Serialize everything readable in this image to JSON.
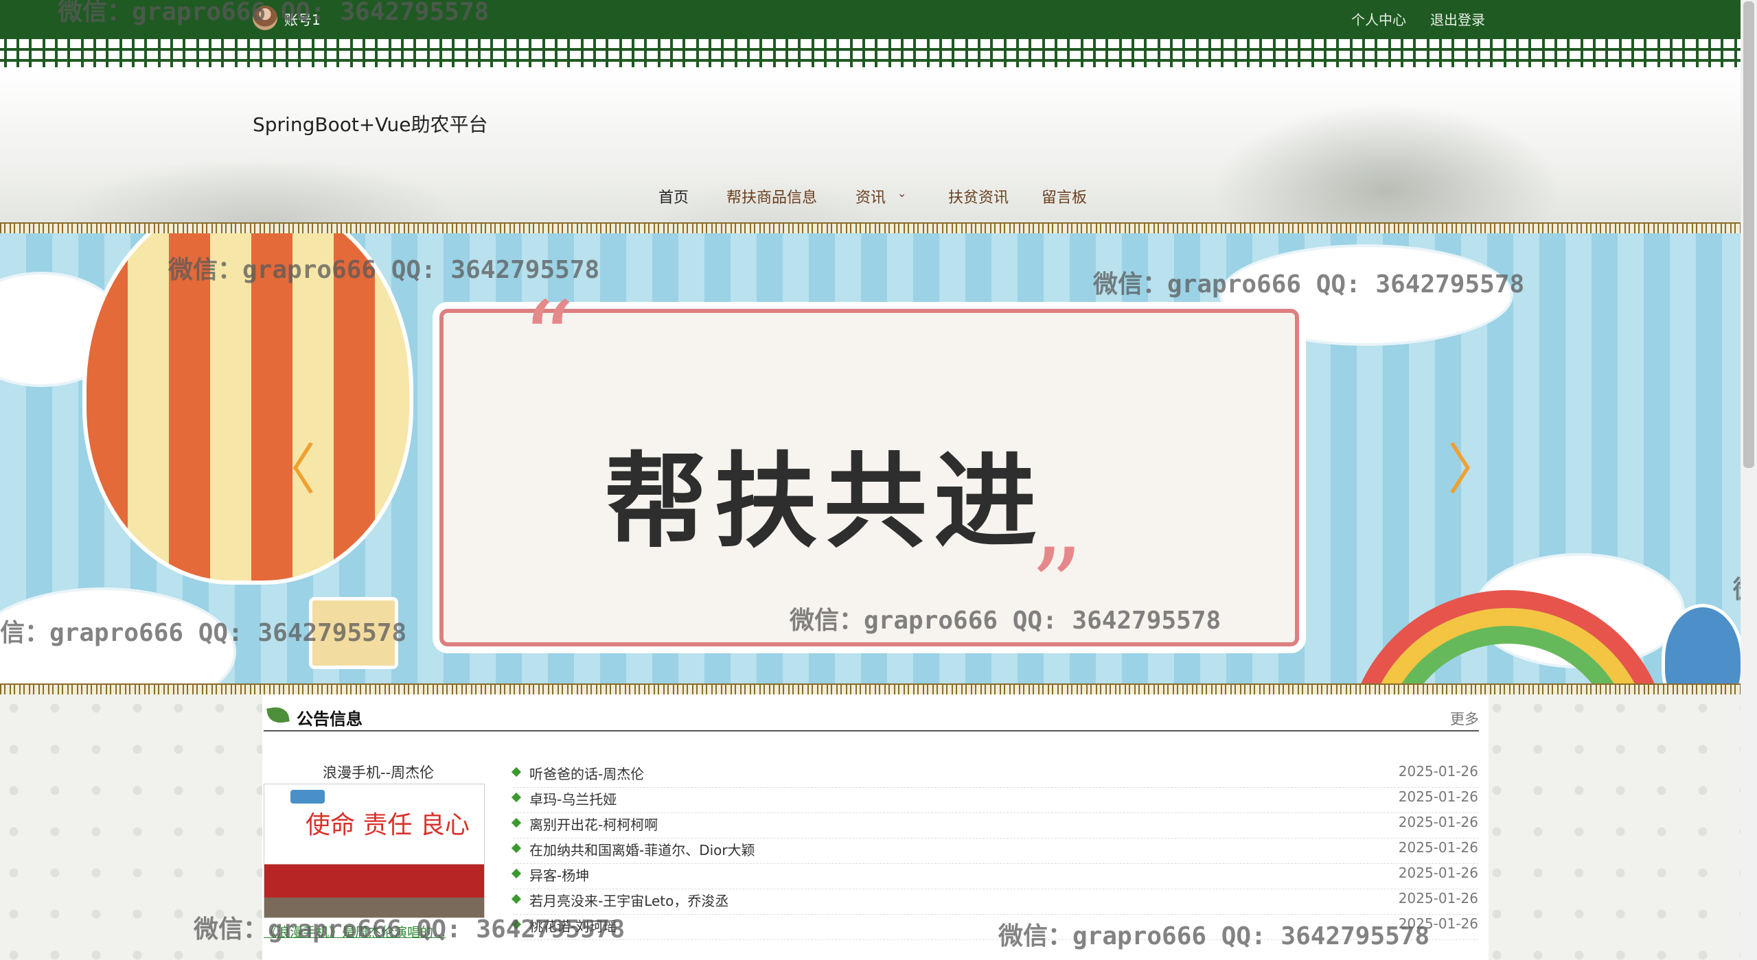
{
  "topbar": {
    "account": "账号1",
    "user_center": "个人中心",
    "logout": "退出登录"
  },
  "site": {
    "title": "SpringBoot+Vue助农平台"
  },
  "nav": {
    "home": "首页",
    "goods": "帮扶商品信息",
    "news": "资讯",
    "news_chevron": "⌄",
    "poverty_news": "扶贫资讯",
    "message_board": "留言板"
  },
  "banner": {
    "text": "帮扶共进",
    "prev": "〈",
    "next": "〉",
    "open_quote": "“",
    "close_quote": "”"
  },
  "notice": {
    "title": "公告信息",
    "more": "更多",
    "feature": {
      "title": "浪漫手机--周杰伦",
      "image_text": "使命 责任 良心",
      "caption": "《浪漫手机》是周杰伦演唱的..."
    },
    "items": [
      {
        "title": "听爸爸的话-周杰伦",
        "date": "2025-01-26"
      },
      {
        "title": "卓玛-乌兰托娅",
        "date": "2025-01-26"
      },
      {
        "title": "离别开出花-柯柯柯啊",
        "date": "2025-01-26"
      },
      {
        "title": "在加纳共和国离婚-菲道尔、Dior大颖",
        "date": "2025-01-26"
      },
      {
        "title": "异客-杨坤",
        "date": "2025-01-26"
      },
      {
        "title": "若月亮没来-王宇宙Leto，乔浚丞",
        "date": "2025-01-26"
      },
      {
        "title": "桃花诺-刘珂瑶",
        "date": "2025-01-26"
      }
    ]
  },
  "watermarks": [
    "微信：grapro666 QQ: 3642795578",
    "微信：grapro666 QQ: 3642795578",
    "微信：grapro666 QQ: 3642795578",
    "信：grapro666 QQ: 3642795578",
    "微信：grapro666 QQ: 3642795578",
    "微信：grapro666 QQ: 3642795578",
    "微信：grapro666 QQ: 3642795578",
    "微"
  ]
}
